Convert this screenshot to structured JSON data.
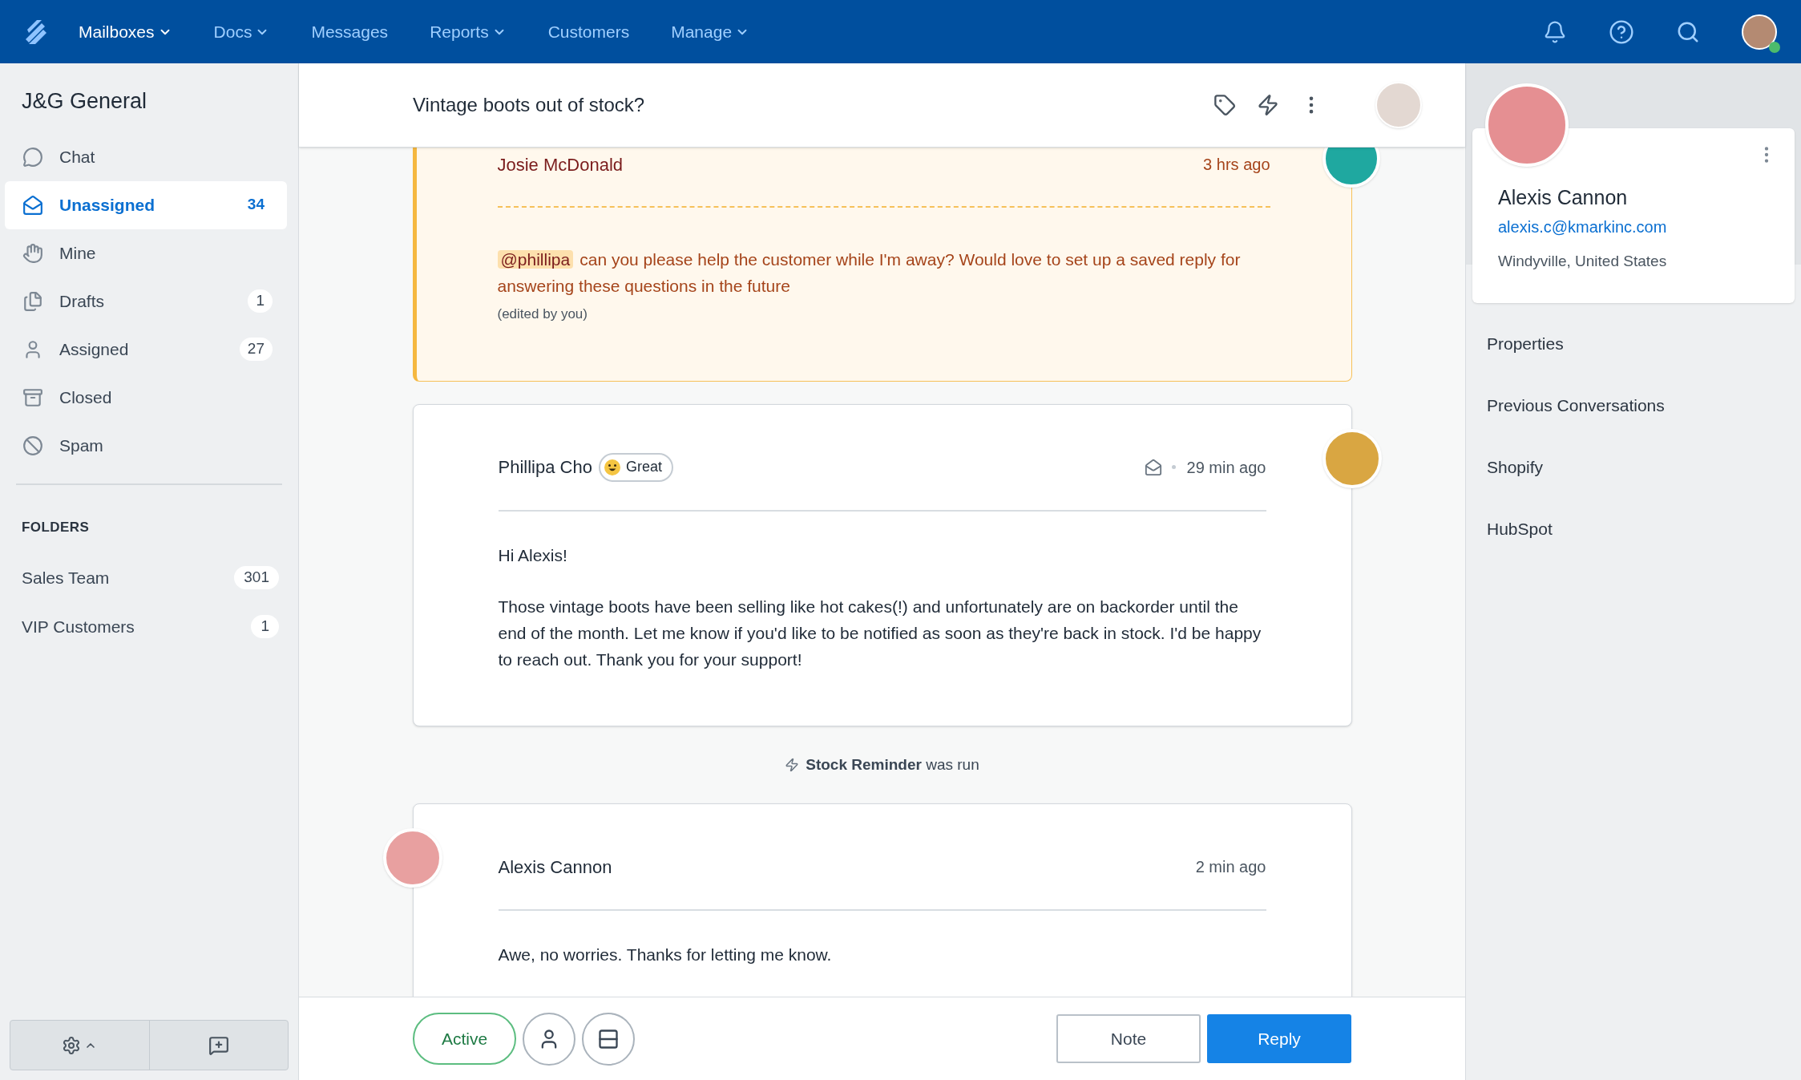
{
  "nav": {
    "items": [
      {
        "label": "Mailboxes",
        "dropdown": true,
        "selected": true
      },
      {
        "label": "Docs",
        "dropdown": true,
        "selected": false
      },
      {
        "label": "Messages",
        "dropdown": false,
        "selected": false
      },
      {
        "label": "Reports",
        "dropdown": true,
        "selected": false
      },
      {
        "label": "Customers",
        "dropdown": false,
        "selected": false
      },
      {
        "label": "Manage",
        "dropdown": true,
        "selected": false
      }
    ]
  },
  "user": {
    "online": true
  },
  "sidebar": {
    "title": "J&G General",
    "items": [
      {
        "label": "Chat",
        "selected": false
      },
      {
        "label": "Unassigned",
        "count": "34",
        "selected": true
      },
      {
        "label": "Mine",
        "selected": false
      },
      {
        "label": "Drafts",
        "count": "1",
        "selected": false
      },
      {
        "label": "Assigned",
        "count": "27",
        "selected": false
      },
      {
        "label": "Closed",
        "selected": false
      },
      {
        "label": "Spam",
        "selected": false
      }
    ],
    "folders_heading": "FOLDERS",
    "folders": [
      {
        "label": "Sales Team",
        "count": "301"
      },
      {
        "label": "VIP Customers",
        "count": "1"
      }
    ]
  },
  "conversation": {
    "title": "Vintage boots out of stock?",
    "messages": [
      {
        "kind": "note",
        "author": "Josie McDonald",
        "time": "3 hrs ago",
        "mention": "@phillipa",
        "text": "can you please help the customer while I'm away? Would love to set up a saved reply for answering these questions in the future",
        "edited": "(edited by you)"
      },
      {
        "kind": "reply",
        "author": "Phillipa Cho",
        "reaction": "Great",
        "time": "29 min ago",
        "paragraphs": [
          "Hi Alexis!",
          "Those vintage boots have been selling like hot cakes(!) and unfortunately are on backorder until the end of the month. Let me know if you'd like to be notified as soon as they're back in stock. I'd be happy to reach out. Thank you for your support!"
        ]
      },
      {
        "kind": "event",
        "text": "**Stock Reminder** was run"
      },
      {
        "kind": "customer",
        "author": "Alexis Cannon",
        "time": "2 min ago",
        "paragraphs": [
          "Awe, no worries. Thanks for letting me know."
        ]
      }
    ],
    "status": "Active",
    "buttons": [
      {
        "label": "Note",
        "primary": false
      },
      {
        "label": "Reply",
        "primary": true
      }
    ]
  },
  "customer": {
    "name": "Alexis Cannon",
    "email": "alexis.c@kmarkinc.com",
    "location": "Windyville, United States",
    "sections": [
      "Properties",
      "Previous Conversations",
      "Shopify",
      "HubSpot"
    ]
  }
}
